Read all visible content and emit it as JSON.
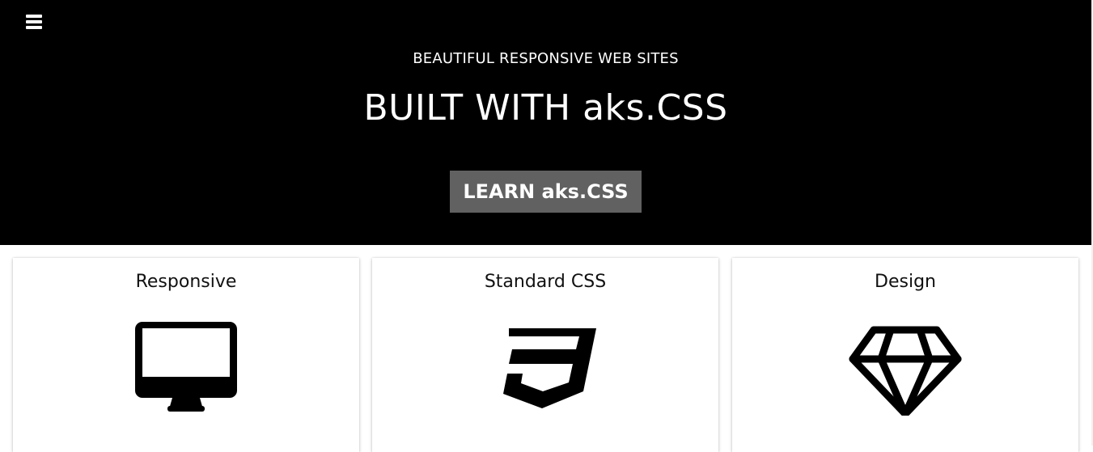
{
  "hero": {
    "menu_icon": "hamburger-menu-icon",
    "subtitle": "BEAUTIFUL RESPONSIVE WEB SITES",
    "title": "BUILT WITH aks.CSS",
    "cta_label": "LEARN aks.CSS"
  },
  "features": [
    {
      "title": "Responsive",
      "icon": "desktop-icon"
    },
    {
      "title": "Standard CSS",
      "icon": "css3-icon"
    },
    {
      "title": "Design",
      "icon": "diamond-icon"
    }
  ],
  "colors": {
    "hero_bg": "#000000",
    "cta_bg": "#616161",
    "text_light": "#ffffff",
    "card_bg": "#ffffff"
  }
}
